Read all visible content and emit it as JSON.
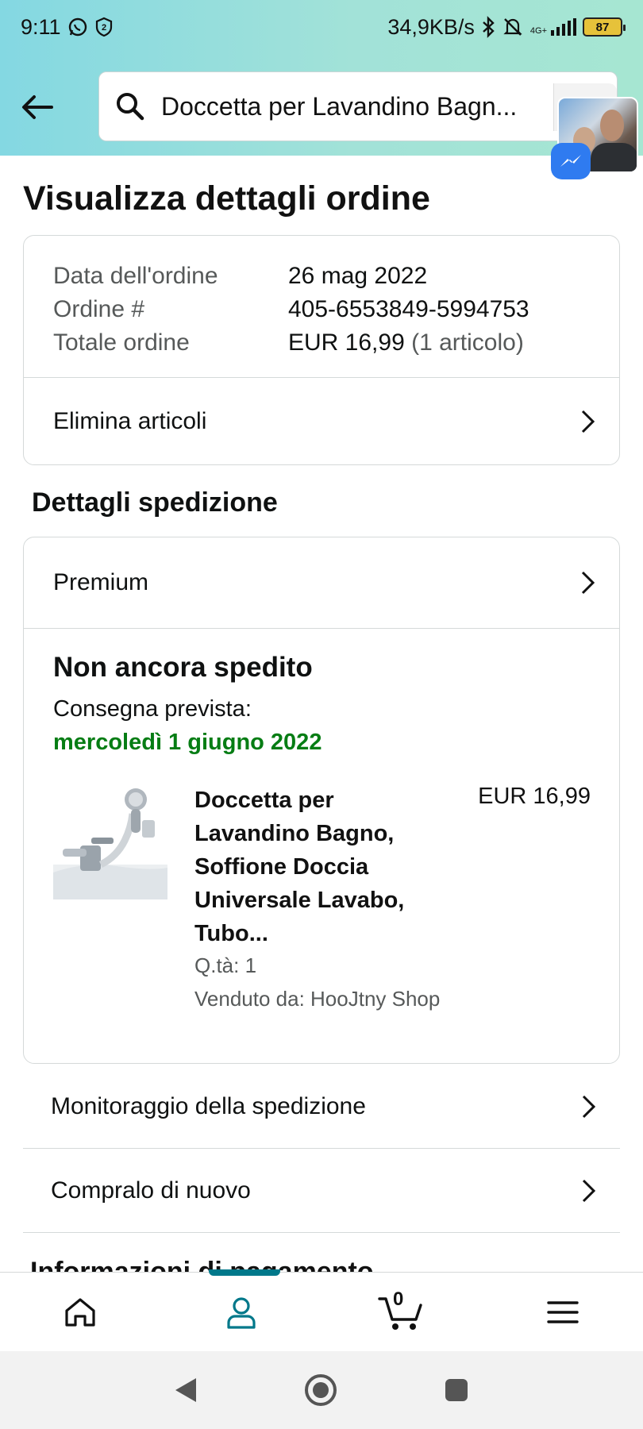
{
  "status_bar": {
    "time": "9:11",
    "speed": "34,9KB/s",
    "network": "4G+",
    "battery": "87"
  },
  "header": {
    "search_query": "Doccetta per Lavandino Bagn..."
  },
  "page": {
    "title": "Visualizza dettagli ordine"
  },
  "order_summary": {
    "rows": [
      {
        "label": "Data dell'ordine",
        "value": "26 mag 2022"
      },
      {
        "label": "Ordine #",
        "value": "405-6553849-5994753"
      },
      {
        "label": "Totale ordine",
        "value": "EUR 16,99",
        "extra": "(1 articolo)"
      }
    ],
    "delete_link": "Elimina articoli"
  },
  "shipping": {
    "section_title": "Dettagli spedizione",
    "service": "Premium",
    "status": "Non ancora spedito",
    "eta_label": "Consegna prevista:",
    "eta_date": "mercoledì 1 giugno 2022",
    "product": {
      "title": "Doccetta per Lavandino Bagno, Soffione Doccia Universale Lavabo, Tubo...",
      "price": "EUR 16,99",
      "qty": "Q.tà: 1",
      "seller": "Venduto da: HooJtny Shop"
    }
  },
  "actions": {
    "track": "Monitoraggio della spedizione",
    "buy_again": "Compralo di nuovo"
  },
  "next_section": "Informazioni di pagamento",
  "tabbar": {
    "cart_count": "0",
    "active_color": "#00788a"
  },
  "colors": {
    "eta_green": "#067d14",
    "header_gradient_start": "#84d8e2",
    "header_gradient_end": "#a6e6d2"
  }
}
